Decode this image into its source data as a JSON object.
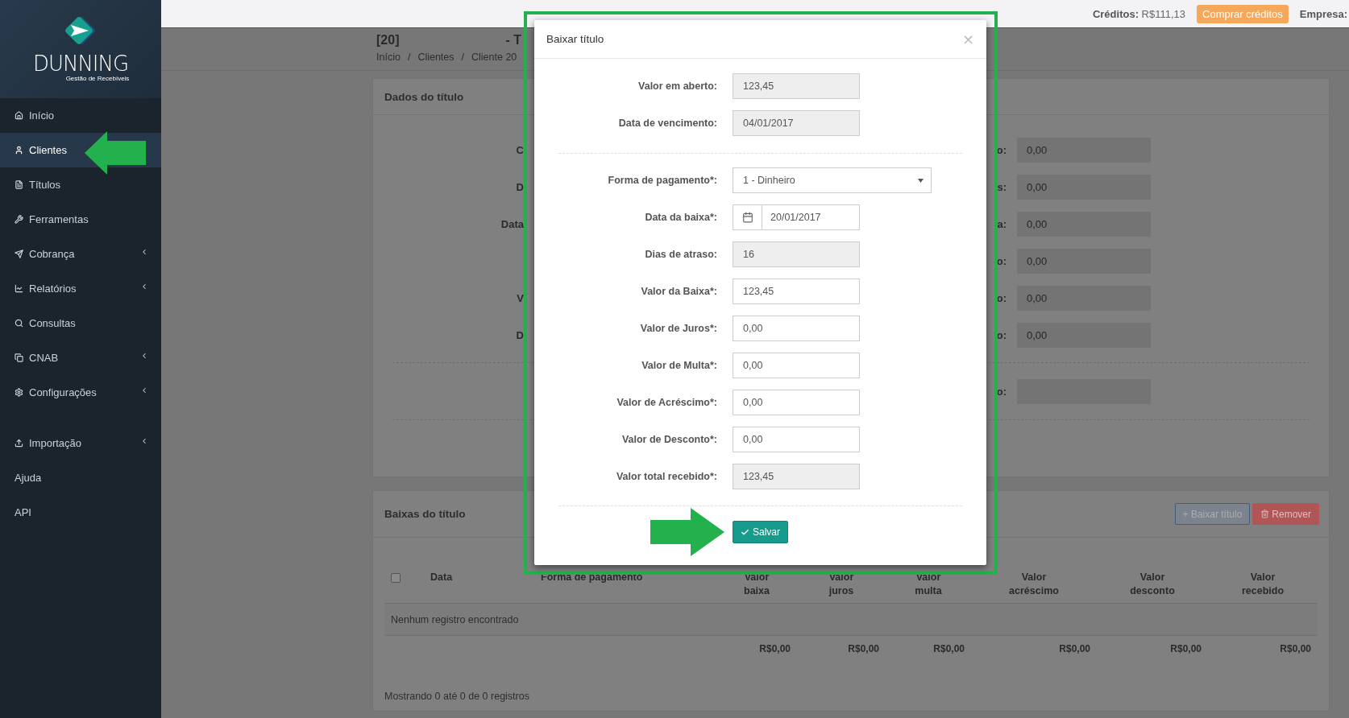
{
  "sidebar": {
    "logo": {
      "name": "DUNNING",
      "tagline": "Gestão de Recebíveis"
    },
    "sections": [
      [
        {
          "label": "Início",
          "selected": false,
          "submenu": false
        },
        {
          "label": "Clientes",
          "selected": true,
          "submenu": false
        },
        {
          "label": "Títulos",
          "selected": false,
          "submenu": false
        },
        {
          "label": "Ferramentas",
          "selected": false,
          "submenu": false
        },
        {
          "label": "Cobrança",
          "selected": false,
          "submenu": true
        },
        {
          "label": "Relatórios",
          "selected": false,
          "submenu": true
        },
        {
          "label": "Consultas",
          "selected": false,
          "submenu": false
        },
        {
          "label": "CNAB",
          "selected": false,
          "submenu": true
        },
        {
          "label": "Configurações",
          "selected": false,
          "submenu": true
        }
      ],
      [
        {
          "label": "Importação",
          "selected": false,
          "submenu": true
        },
        {
          "label": "Ajuda",
          "selected": false,
          "submenu": false
        },
        {
          "label": "API",
          "selected": false,
          "submenu": false
        }
      ]
    ]
  },
  "topbar": {
    "credits_label": "Créditos:",
    "credits_value": "R$111,13",
    "buy_button": "Comprar créditos",
    "company_label": "Empresa:"
  },
  "page": {
    "id": "[20]",
    "title": "- T",
    "breadcrumb": [
      "Início",
      "Clientes",
      "Cliente 20"
    ],
    "separator": "/"
  },
  "details_panel": {
    "title": "Dados do título",
    "rows": [
      {
        "left_label": "C",
        "right_label": "o:",
        "value": "0,00"
      },
      {
        "left_label": "D",
        "right_label": "s:",
        "value": "0,00"
      },
      {
        "left_label": "Data",
        "right_label": "a:",
        "value": "0,00"
      },
      {
        "right_label": "o:",
        "value": "0,00"
      },
      {
        "left_label": "V",
        "right_label": "o:",
        "value": "0,00"
      },
      {
        "left_label": "D",
        "right_label": "o:",
        "value": "0,00"
      }
    ],
    "extra_row": {
      "right_label": "o:"
    }
  },
  "payments_panel": {
    "title": "Baixas do título",
    "buttons": [
      {
        "label": "+ Baixar título",
        "kind": "primary"
      },
      {
        "label": "Remover",
        "kind": "danger"
      }
    ],
    "table": {
      "select_all_checked": false,
      "columns": [
        "Data",
        "Forma de pagamento",
        "Valor baixa",
        "Valor juros",
        "Valor multa",
        "Valor acréscimo",
        "Valor desconto",
        "Valor recebido"
      ],
      "empty_message": "Nenhum registro encontrado",
      "totals": [
        "R$0,00",
        "R$0,00",
        "R$0,00",
        "R$0,00",
        "R$0,00",
        "R$0,00"
      ]
    },
    "footer": "Mostrando 0 até 0 de 0 registros"
  },
  "modal": {
    "title": "Baixar título",
    "close": "×",
    "groups": [
      [
        {
          "label": "Valor em aberto:",
          "value": "123,45",
          "kind": "readonly"
        },
        {
          "label": "Data de vencimento:",
          "value": "04/01/2017",
          "kind": "readonly"
        }
      ],
      [
        {
          "label": "Forma de pagamento*:",
          "value": "1 - Dinheiro",
          "kind": "select"
        },
        {
          "label": "Data da baixa*:",
          "value": "20/01/2017",
          "kind": "date"
        },
        {
          "label": "Dias de atraso:",
          "value": "16",
          "kind": "readonly"
        },
        {
          "label": "Valor da Baixa*:",
          "value": "123,45",
          "kind": "input"
        },
        {
          "label": "Valor de Juros*:",
          "value": "0,00",
          "kind": "input"
        },
        {
          "label": "Valor de Multa*:",
          "value": "0,00",
          "kind": "input"
        },
        {
          "label": "Valor de Acréscimo*:",
          "value": "0,00",
          "kind": "input"
        },
        {
          "label": "Valor de Desconto*:",
          "value": "0,00",
          "kind": "input"
        },
        {
          "label": "Valor total recebido*:",
          "value": "123,45",
          "kind": "readonly"
        }
      ]
    ],
    "save_button": "Salvar"
  }
}
